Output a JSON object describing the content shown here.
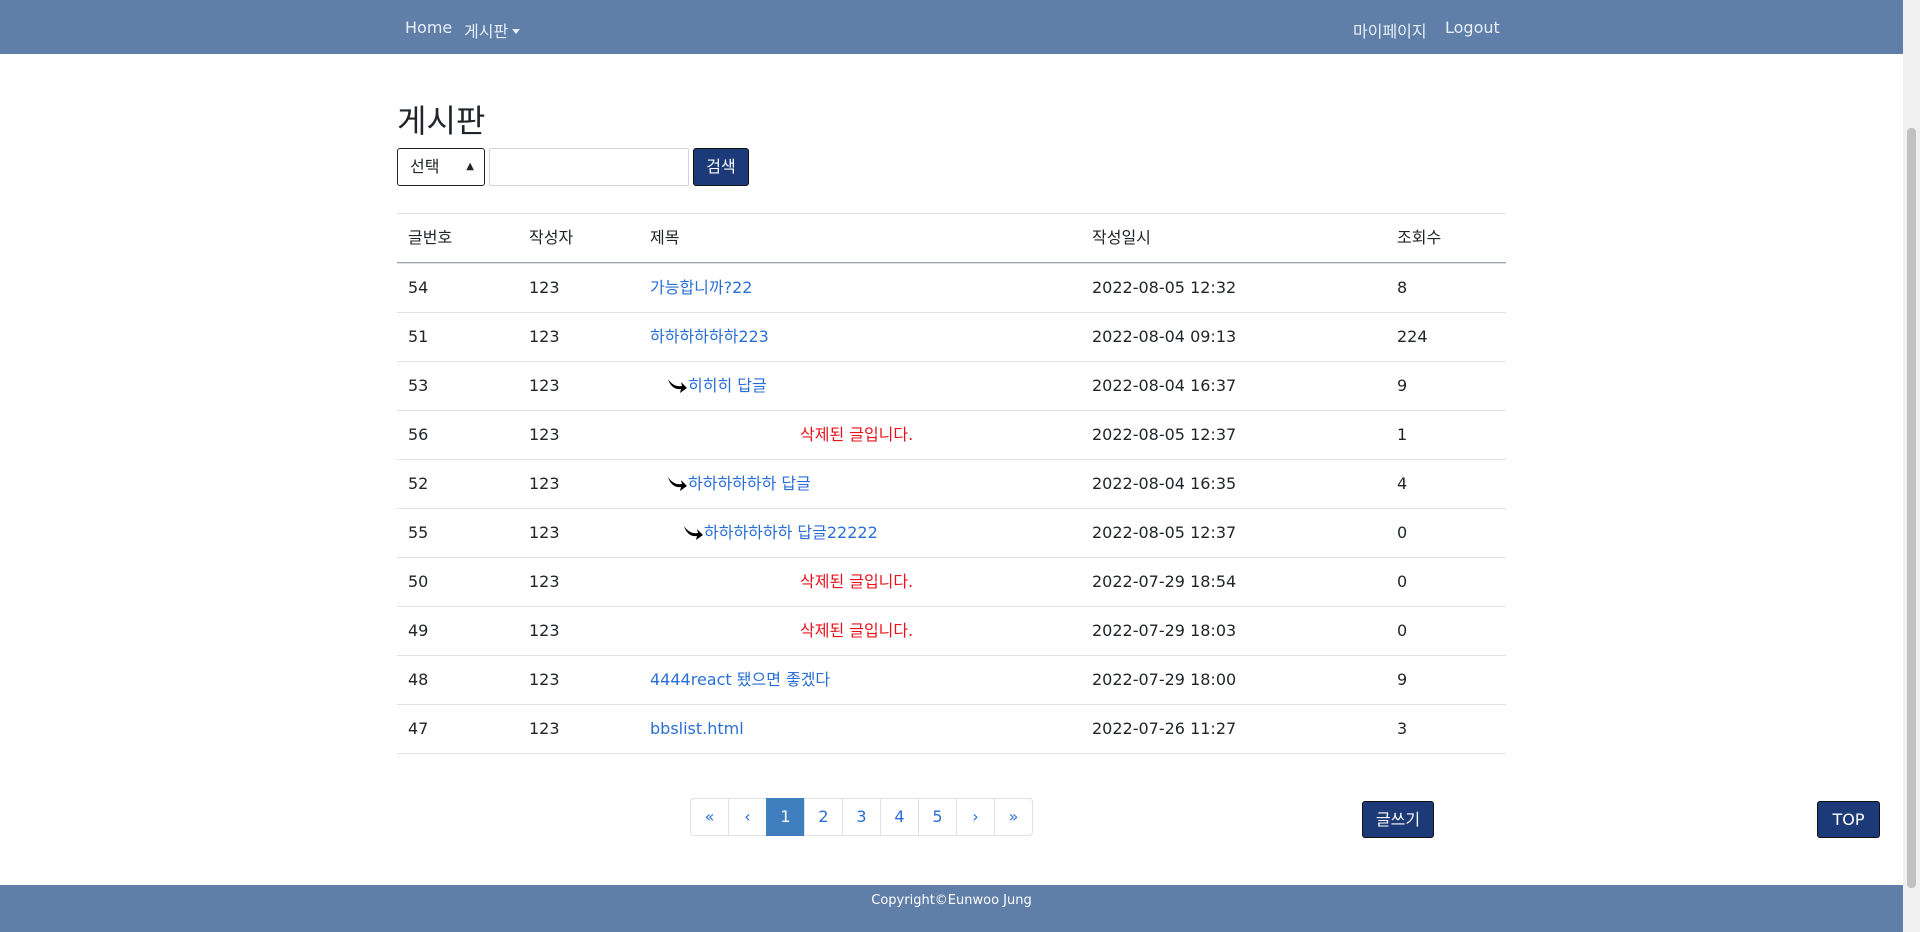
{
  "navbar": {
    "home": "Home",
    "board": "게시판",
    "mypage": "마이페이지",
    "logout": "Logout"
  },
  "page_title": "게시판",
  "search": {
    "select_value": "선택",
    "input_value": "",
    "button": "검색"
  },
  "table": {
    "headers": [
      "글번호",
      "작성자",
      "제목",
      "작성일시",
      "조회수"
    ],
    "rows": [
      {
        "no": "54",
        "writer": "123",
        "title": "가능합니까?22",
        "date": "2022-08-05 12:32",
        "views": "8"
      },
      {
        "no": "51",
        "writer": "123",
        "title": "하하하하하하223",
        "date": "2022-08-04 09:13",
        "views": "224"
      },
      {
        "no": "53",
        "writer": "123",
        "title": "히히히 답글",
        "date": "2022-08-04 16:37",
        "views": "9"
      },
      {
        "no": "56",
        "writer": "123",
        "title": "삭제된 글입니다.",
        "date": "2022-08-05 12:37",
        "views": "1"
      },
      {
        "no": "52",
        "writer": "123",
        "title": "하하하하하하 답글",
        "date": "2022-08-04 16:35",
        "views": "4"
      },
      {
        "no": "55",
        "writer": "123",
        "title": "하하하하하하 답글22222",
        "date": "2022-08-05 12:37",
        "views": "0"
      },
      {
        "no": "50",
        "writer": "123",
        "title": "삭제된 글입니다.",
        "date": "2022-07-29 18:54",
        "views": "0"
      },
      {
        "no": "49",
        "writer": "123",
        "title": "삭제된 글입니다.",
        "date": "2022-07-29 18:03",
        "views": "0"
      },
      {
        "no": "48",
        "writer": "123",
        "title": "4444react 됐으면 좋겠다",
        "date": "2022-07-29 18:00",
        "views": "9"
      },
      {
        "no": "47",
        "writer": "123",
        "title": "bbslist.html",
        "date": "2022-07-26 11:27",
        "views": "3"
      }
    ]
  },
  "pagination": {
    "first": "«",
    "prev": "‹",
    "pages": [
      "1",
      "2",
      "3",
      "4",
      "5"
    ],
    "current": "1",
    "next": "›",
    "last": "»"
  },
  "write_button": "글쓰기",
  "top_button": "TOP",
  "footer": {
    "copyright": "Copyright©Eunwoo Jung"
  },
  "colors": {
    "navbar_bg": "#5f7fa9",
    "button_bg": "#1c3a78",
    "link": "#2a6fd6",
    "deleted": "#e8121b",
    "active_page": "#3f7fbf"
  },
  "icons": {
    "reply": "reply-arrow-icon",
    "dropdown": "caret-down-icon",
    "select": "sort-arrows-icon"
  }
}
